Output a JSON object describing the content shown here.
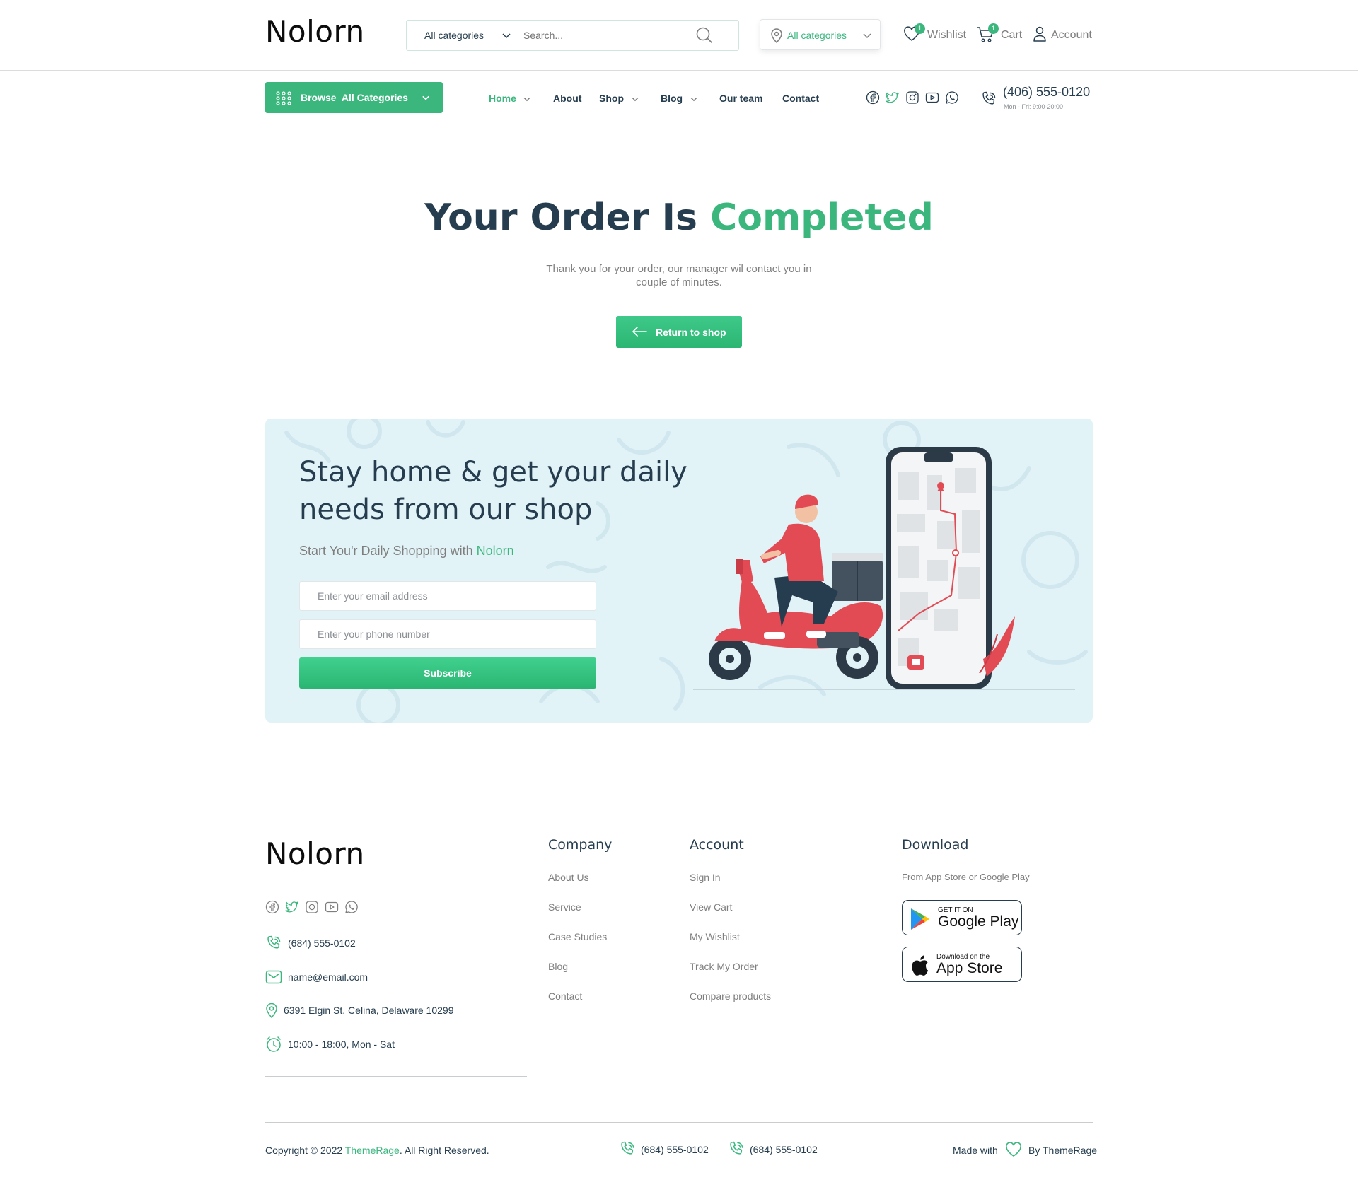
{
  "header": {
    "logo": "Nolorn",
    "search": {
      "category": "All categories",
      "placeholder": "Search..."
    },
    "location": "All categories",
    "wishlist": {
      "label": "Wishlist",
      "count": "1"
    },
    "cart": {
      "label": "Cart",
      "count": "1"
    },
    "account": {
      "label": "Account"
    }
  },
  "nav": {
    "browse_label": "Browse  All Categories",
    "links": [
      "Home",
      "About",
      "Shop",
      "Blog",
      "Our team",
      "Contact"
    ],
    "phone": "(406) 555-0120",
    "hours": "Mon - Fri: 9:00-20:00"
  },
  "hero": {
    "title_main": "Your Order Is ",
    "title_highlight": "Completed",
    "subtitle": "Thank you for your order, our manager wil contact you in couple of minutes.",
    "button": "Return to shop"
  },
  "banner": {
    "title": "Stay home & get your daily needs from our shop",
    "subtitle": "Start You'r Daily Shopping with ",
    "brand": "Nolorn",
    "email_placeholder": "Enter your email address",
    "phone_placeholder": "Enter your phone number",
    "subscribe": "Subscribe"
  },
  "footer": {
    "logo": "Nolorn",
    "contact": {
      "phone": "(684) 555-0102",
      "email": "name@email.com",
      "address": "6391 Elgin St. Celina, Delaware 10299",
      "hours": "10:00 - 18:00, Mon - Sat"
    },
    "company": {
      "heading": "Company",
      "links": [
        "About Us",
        "Service",
        "Case Studies",
        "Blog",
        "Contact"
      ]
    },
    "account": {
      "heading": "Account",
      "links": [
        "Sign In",
        "View Cart",
        "My Wishlist",
        "Track My Order",
        "Compare products"
      ]
    },
    "download": {
      "heading": "Download",
      "subtitle": "From App Store or Google Play",
      "google_small": "GET IT ON",
      "google_big": "Google Play",
      "apple_small": "Download on the",
      "apple_big": "App Store"
    },
    "bottom": {
      "copyright_prefix": "Copyright © 2022 ",
      "copyright_brand": "ThemeRage",
      "copyright_suffix": ". All Right Reserved.",
      "phone1": "(684) 555-0102",
      "phone2": "(684) 555-0102",
      "made_with": "Made with",
      "by": "By ThemeRage"
    }
  },
  "colors": {
    "accent": "#3bb77e",
    "heading": "#253d4e",
    "muted": "#7e7e7e",
    "banner_bg": "#e2f3f7"
  },
  "icons": [
    "search-icon",
    "location-pin-icon",
    "heart-icon",
    "cart-icon",
    "user-icon",
    "grid-dots-icon",
    "chevron-down-icon",
    "facebook-icon",
    "twitter-icon",
    "instagram-icon",
    "youtube-icon",
    "whatsapp-icon",
    "phone-icon",
    "mail-icon",
    "clock-icon",
    "arrow-left-icon",
    "google-play-icon",
    "apple-icon"
  ]
}
